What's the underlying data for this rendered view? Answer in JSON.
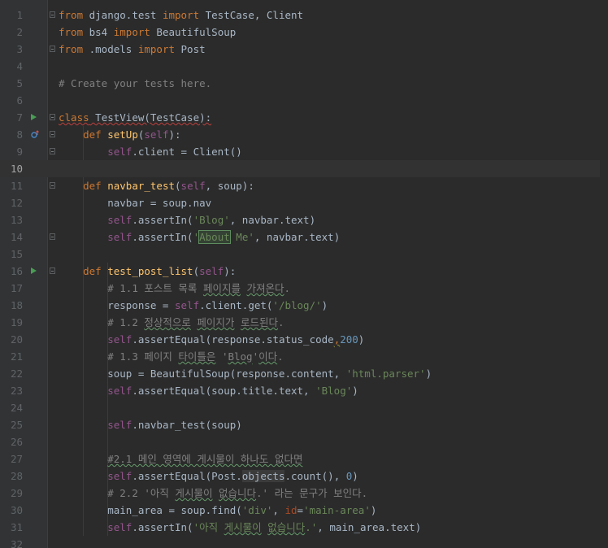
{
  "editor": {
    "current_line": 10,
    "lines": [
      {
        "n": "1",
        "tokens": [
          {
            "t": "from",
            "c": "kw"
          },
          {
            "t": " django.test "
          },
          {
            "t": "import",
            "c": "kw"
          },
          {
            "t": " TestCase, Client"
          }
        ]
      },
      {
        "n": "2",
        "tokens": [
          {
            "t": "from",
            "c": "kw"
          },
          {
            "t": " bs4 "
          },
          {
            "t": "import",
            "c": "kw"
          },
          {
            "t": " BeautifulSoup"
          }
        ]
      },
      {
        "n": "3",
        "tokens": [
          {
            "t": "from",
            "c": "kw"
          },
          {
            "t": " .models "
          },
          {
            "t": "import",
            "c": "kw"
          },
          {
            "t": " Post"
          }
        ]
      },
      {
        "n": "4",
        "tokens": []
      },
      {
        "n": "5",
        "tokens": [
          {
            "t": "# Create your tests here.",
            "c": "cmt"
          }
        ]
      },
      {
        "n": "6",
        "tokens": []
      },
      {
        "n": "7",
        "icon": "run",
        "tokens": [
          {
            "t": "class",
            "c": "kw warn"
          },
          {
            "t": " TestView(TestCase):",
            "c": "warn"
          }
        ]
      },
      {
        "n": "8",
        "icon": "override",
        "tokens": [
          {
            "t": "    "
          },
          {
            "t": "def",
            "c": "kw"
          },
          {
            "t": " "
          },
          {
            "t": "setUp",
            "c": "fn"
          },
          {
            "t": "("
          },
          {
            "t": "self",
            "c": "self"
          },
          {
            "t": "):"
          }
        ]
      },
      {
        "n": "9",
        "tokens": [
          {
            "t": "        "
          },
          {
            "t": "self",
            "c": "self"
          },
          {
            "t": ".client = Client()"
          }
        ]
      },
      {
        "n": "10",
        "tokens": []
      },
      {
        "n": "11",
        "tokens": [
          {
            "t": "    "
          },
          {
            "t": "def",
            "c": "kw"
          },
          {
            "t": " "
          },
          {
            "t": "navbar_test",
            "c": "fn"
          },
          {
            "t": "("
          },
          {
            "t": "self",
            "c": "self"
          },
          {
            "t": ", soup):"
          }
        ]
      },
      {
        "n": "12",
        "tokens": [
          {
            "t": "        navbar = soup.nav"
          }
        ]
      },
      {
        "n": "13",
        "tokens": [
          {
            "t": "        "
          },
          {
            "t": "self",
            "c": "self"
          },
          {
            "t": ".assertIn("
          },
          {
            "t": "'Blog'",
            "c": "str"
          },
          {
            "t": ", navbar.text)"
          }
        ]
      },
      {
        "n": "14",
        "tokens": [
          {
            "t": "        "
          },
          {
            "t": "self",
            "c": "self"
          },
          {
            "t": ".assertIn("
          },
          {
            "t": "'",
            "c": "str"
          },
          {
            "t": "About",
            "c": "str hl-occ"
          },
          {
            "t": " Me'",
            "c": "str"
          },
          {
            "t": ", navbar.text)"
          }
        ]
      },
      {
        "n": "15",
        "tokens": []
      },
      {
        "n": "16",
        "icon": "run",
        "tokens": [
          {
            "t": "    "
          },
          {
            "t": "def",
            "c": "kw"
          },
          {
            "t": " "
          },
          {
            "t": "test_post_list",
            "c": "fn"
          },
          {
            "t": "("
          },
          {
            "t": "self",
            "c": "self"
          },
          {
            "t": "):"
          }
        ]
      },
      {
        "n": "17",
        "tokens": [
          {
            "t": "        "
          },
          {
            "t": "# 1.1 포스트 목록 ",
            "c": "cmt"
          },
          {
            "t": "페이지를",
            "c": "cmt typo"
          },
          {
            "t": " ",
            "c": "cmt"
          },
          {
            "t": "가져온다",
            "c": "cmt typo"
          },
          {
            "t": ".",
            "c": "cmt"
          }
        ]
      },
      {
        "n": "18",
        "tokens": [
          {
            "t": "        response = "
          },
          {
            "t": "self",
            "c": "self"
          },
          {
            "t": ".client.get("
          },
          {
            "t": "'/blog/'",
            "c": "str"
          },
          {
            "t": ")"
          }
        ]
      },
      {
        "n": "19",
        "tokens": [
          {
            "t": "        "
          },
          {
            "t": "# 1.2 ",
            "c": "cmt"
          },
          {
            "t": "정상적으로",
            "c": "cmt typo"
          },
          {
            "t": " ",
            "c": "cmt"
          },
          {
            "t": "페이지가",
            "c": "cmt typo"
          },
          {
            "t": " ",
            "c": "cmt"
          },
          {
            "t": "로드된다",
            "c": "cmt typo"
          },
          {
            "t": ".",
            "c": "cmt"
          }
        ]
      },
      {
        "n": "20",
        "tokens": [
          {
            "t": "        "
          },
          {
            "t": "self",
            "c": "self"
          },
          {
            "t": ".assertEqual(response.status_code"
          },
          {
            "t": ",",
            "c": "kw weak"
          },
          {
            "t": "200",
            "c": "num"
          },
          {
            "t": ")"
          }
        ]
      },
      {
        "n": "21",
        "tokens": [
          {
            "t": "        "
          },
          {
            "t": "# 1.3 페이지 ",
            "c": "cmt"
          },
          {
            "t": "타이틀은",
            "c": "cmt typo"
          },
          {
            "t": " '",
            "c": "cmt"
          },
          {
            "t": "Blog",
            "c": "cmt typo"
          },
          {
            "t": "'",
            "c": "cmt"
          },
          {
            "t": "이다",
            "c": "cmt typo"
          },
          {
            "t": ".",
            "c": "cmt"
          }
        ]
      },
      {
        "n": "22",
        "tokens": [
          {
            "t": "        soup = BeautifulSoup(response.content, "
          },
          {
            "t": "'html.parser'",
            "c": "str"
          },
          {
            "t": ")"
          }
        ]
      },
      {
        "n": "23",
        "tokens": [
          {
            "t": "        "
          },
          {
            "t": "self",
            "c": "self"
          },
          {
            "t": ".assertEqual(soup.title.text, "
          },
          {
            "t": "'Blog'",
            "c": "str"
          },
          {
            "t": ")"
          }
        ]
      },
      {
        "n": "24",
        "tokens": []
      },
      {
        "n": "25",
        "tokens": [
          {
            "t": "        "
          },
          {
            "t": "self",
            "c": "self"
          },
          {
            "t": ".navbar_test(soup)"
          }
        ]
      },
      {
        "n": "26",
        "tokens": []
      },
      {
        "n": "27",
        "tokens": [
          {
            "t": "        "
          },
          {
            "t": "#2.1 메인 영역에 게시물이 하나도 없다면",
            "c": "cmt typo"
          }
        ]
      },
      {
        "n": "28",
        "tokens": [
          {
            "t": "        "
          },
          {
            "t": "self",
            "c": "self"
          },
          {
            "t": ".assertEqual(Post."
          },
          {
            "t": "objects",
            "c": "hl-attr"
          },
          {
            "t": ".count(), "
          },
          {
            "t": "0",
            "c": "num"
          },
          {
            "t": ")"
          }
        ]
      },
      {
        "n": "29",
        "tokens": [
          {
            "t": "        "
          },
          {
            "t": "# 2.2 '아직 ",
            "c": "cmt"
          },
          {
            "t": "게시물이",
            "c": "cmt typo"
          },
          {
            "t": " ",
            "c": "cmt"
          },
          {
            "t": "없습니다",
            "c": "cmt typo"
          },
          {
            "t": ".' 라는 문구가 보인다.",
            "c": "cmt"
          }
        ]
      },
      {
        "n": "30",
        "tokens": [
          {
            "t": "        main_area = soup.find("
          },
          {
            "t": "'div'",
            "c": "str"
          },
          {
            "t": ", "
          },
          {
            "t": "id",
            "c": "kwarg"
          },
          {
            "t": "="
          },
          {
            "t": "'main-area'",
            "c": "str"
          },
          {
            "t": ")"
          }
        ]
      },
      {
        "n": "31",
        "tokens": [
          {
            "t": "        "
          },
          {
            "t": "self",
            "c": "self"
          },
          {
            "t": ".assertIn("
          },
          {
            "t": "'아직 ",
            "c": "str"
          },
          {
            "t": "게시물이",
            "c": "str typo"
          },
          {
            "t": " ",
            "c": "str"
          },
          {
            "t": "없습니다",
            "c": "str typo"
          },
          {
            "t": ".'",
            "c": "str"
          },
          {
            "t": ", main_area.text)"
          }
        ]
      },
      {
        "n": "32",
        "tokens": []
      }
    ],
    "folds": [
      1,
      3,
      7,
      8,
      9,
      11,
      14,
      16
    ],
    "colors": {
      "background": "#2b2b2b",
      "keyword": "#cc7832",
      "function": "#ffc66d",
      "self": "#94558d",
      "string": "#6a8759",
      "number": "#6897bb",
      "comment": "#808080"
    }
  }
}
